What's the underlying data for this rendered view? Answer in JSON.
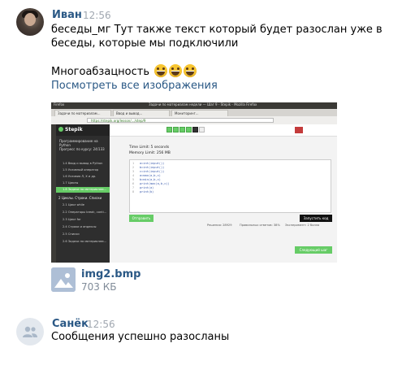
{
  "messages": [
    {
      "author": "Иван",
      "time": "12:56",
      "lines": [
        "беседы_мг Тут также текст который будет разослан уже в",
        "беседы, которые мы подключили"
      ],
      "extra_text": "Многоабзацность",
      "emoji": "grinning-face-icon",
      "emoji_count": 3,
      "view_images_link": "Посмотреть все изображения",
      "screenshot": {
        "window_title": "Задачи по материалам недели — Шаг 9 - Stepik - Mozilla Firefox",
        "top_left": "Firefox",
        "tabs": [
          "Задачи по материалам...",
          "Ввод и вывод...",
          "Мониторинг..."
        ],
        "url": "https://stepik.org/lesson/.../step/9",
        "logo": "Stepik",
        "course_title": "Программирование на Python",
        "progress": "Прогресс по курсу: 24/133",
        "sidebar_items": [
          "1.4  Ввод и вывод в Python",
          "1.5  Условный оператор",
          "1.6  Условия Л, Х и др.",
          "1.7  Циклы",
          "1.8  Задачи по материалам..."
        ],
        "section": "2 Циклы. Строки. Списки",
        "section_items": [
          "2.1  Цикл while",
          "2.2  Операторы break, conti...",
          "2.3  Цикл for",
          "2.4  Строки и индексы",
          "2.5  Списки",
          "2.6  Задачи по материалам..."
        ],
        "time_limit": "Time Limit: 5 seconds",
        "memory_limit": "Memory Limit: 256 MB",
        "code_lines": [
          "a=int(input())",
          "b=int(input())",
          "c=int(input())",
          "a=max(a,b,c)",
          "b=min(a,b,c)",
          "print(max(a,b,c))",
          "print(a)",
          "print(b)"
        ],
        "btn_reset": "Отправить",
        "btn_run": "Запустить код",
        "stats_left": "Решения: 28929",
        "stats_mid": "Правильных ответов: 38%",
        "stats_right": "Эксперимент: 2 баллa",
        "btn_next": "Следующий шаг"
      },
      "file": {
        "name": "img2.bmp",
        "size": "703 КБ"
      }
    },
    {
      "author": "Санёк",
      "time": "12:56",
      "text": "Сообщения успешно разосланы"
    }
  ],
  "colors": {
    "link": "#2a5885",
    "time": "#a0a7b0",
    "accent_green": "#66cc66"
  }
}
